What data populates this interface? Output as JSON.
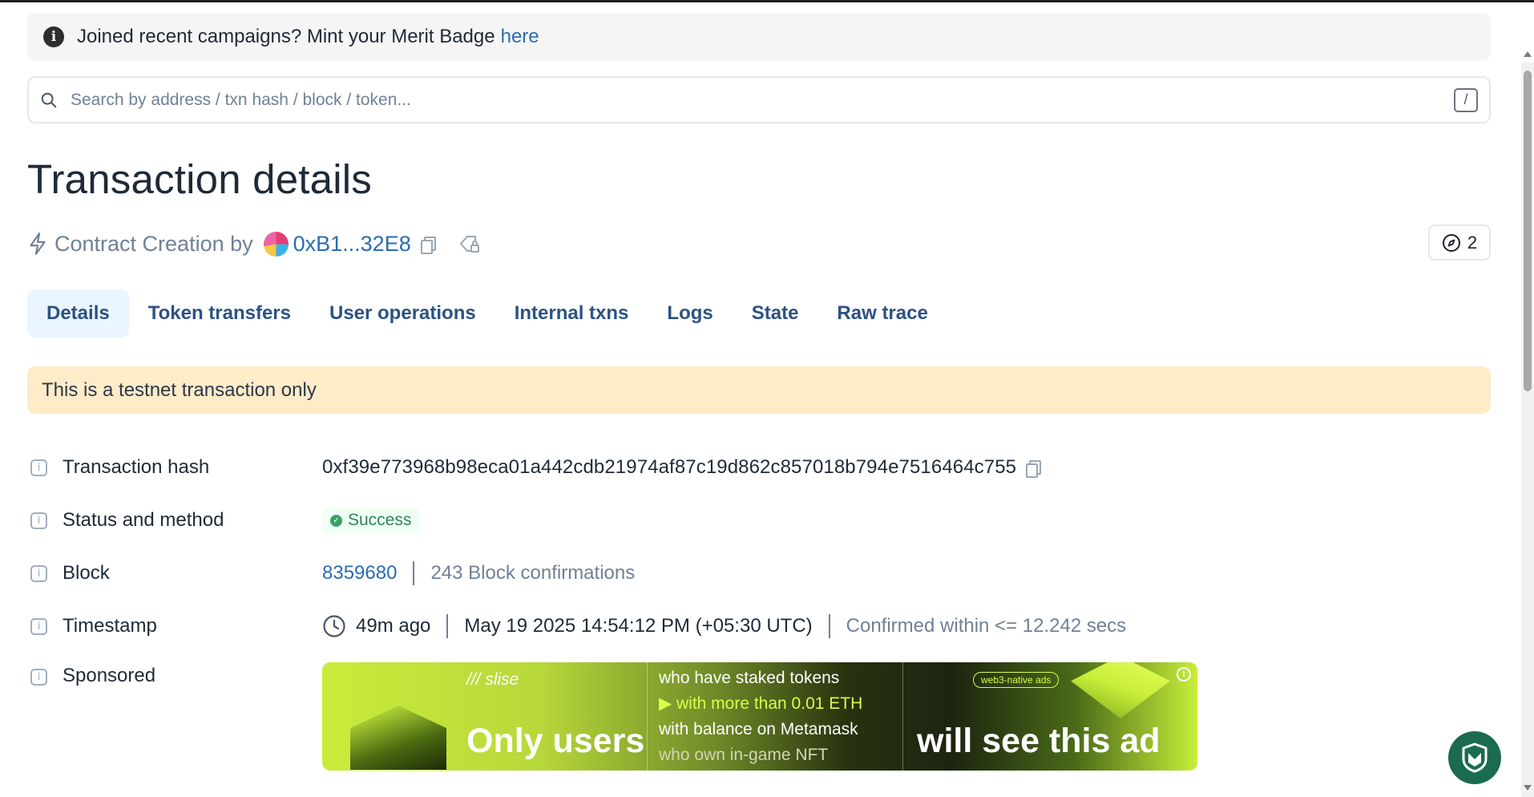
{
  "banner": {
    "text": "Joined recent campaigns? Mint your Merit Badge",
    "link": "here"
  },
  "search": {
    "placeholder": "Search by address / txn hash / block / token...",
    "shortcut": "/"
  },
  "page": {
    "title": "Transaction details"
  },
  "creation": {
    "label": "Contract Creation by",
    "address": "0xB1...32E8",
    "interpretation_count": "2"
  },
  "tabs": [
    {
      "label": "Details",
      "active": true
    },
    {
      "label": "Token transfers"
    },
    {
      "label": "User operations"
    },
    {
      "label": "Internal txns"
    },
    {
      "label": "Logs"
    },
    {
      "label": "State"
    },
    {
      "label": "Raw trace"
    }
  ],
  "notice": "This is a testnet transaction only",
  "details": {
    "hash": {
      "label": "Transaction hash",
      "value": "0xf39e773968b98eca01a442cdb21974af87c19d862c857018b794e7516464c755"
    },
    "status": {
      "label": "Status and method",
      "value": "Success"
    },
    "block": {
      "label": "Block",
      "number": "8359680",
      "confirmations": "243 Block confirmations"
    },
    "timestamp": {
      "label": "Timestamp",
      "ago": "49m ago",
      "datetime": "May 19 2025 14:54:12 PM (+05:30 UTC)",
      "confirmed": "Confirmed within <= 12.242 secs"
    },
    "sponsored": {
      "label": "Sponsored"
    }
  },
  "ad": {
    "brand": "slise",
    "headline_left": "Only users",
    "line1": "who have staked tokens",
    "line2": "with more than 0.01 ETH",
    "line3": "with balance on Metamask",
    "line4": "who own in-game NFT",
    "pill": "web3-native ads",
    "headline_right": "will see this ad",
    "info": "i"
  },
  "colors": {
    "link": "#2b6cb0",
    "tab_active_bg": "#ebf5ff",
    "notice_bg": "#feebc8",
    "success": "#38a169",
    "ad_accent": "#c9ec3b",
    "shield": "#1a6b4f"
  }
}
